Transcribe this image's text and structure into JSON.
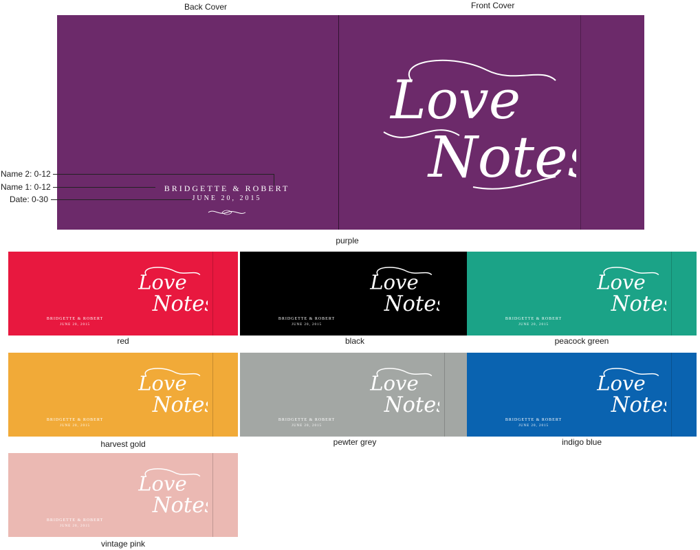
{
  "labels": {
    "back_cover": "Back Cover",
    "front_cover": "Front Cover"
  },
  "main": {
    "color_name": "purple",
    "color": "#6c2a6a",
    "names_text": "BRIDGETTE & ROBERT",
    "date_text": "JUNE 20, 2015",
    "logo_line1": "Love",
    "logo_line2": "Notes"
  },
  "callouts": {
    "name2": "Name 2: 0-12",
    "name1": "Name 1: 0-12",
    "date": "Date: 0-30"
  },
  "swatches": [
    {
      "name": "red",
      "color": "#e8183f"
    },
    {
      "name": "black",
      "color": "#000000"
    },
    {
      "name": "peacock green",
      "color": "#1ba387"
    },
    {
      "name": "harvest gold",
      "color": "#f1aa38"
    },
    {
      "name": "pewter grey",
      "color": "#a3a7a4"
    },
    {
      "name": "indigo blue",
      "color": "#0a63b0"
    },
    {
      "name": "vintage pink",
      "color": "#ebb9b3"
    }
  ]
}
